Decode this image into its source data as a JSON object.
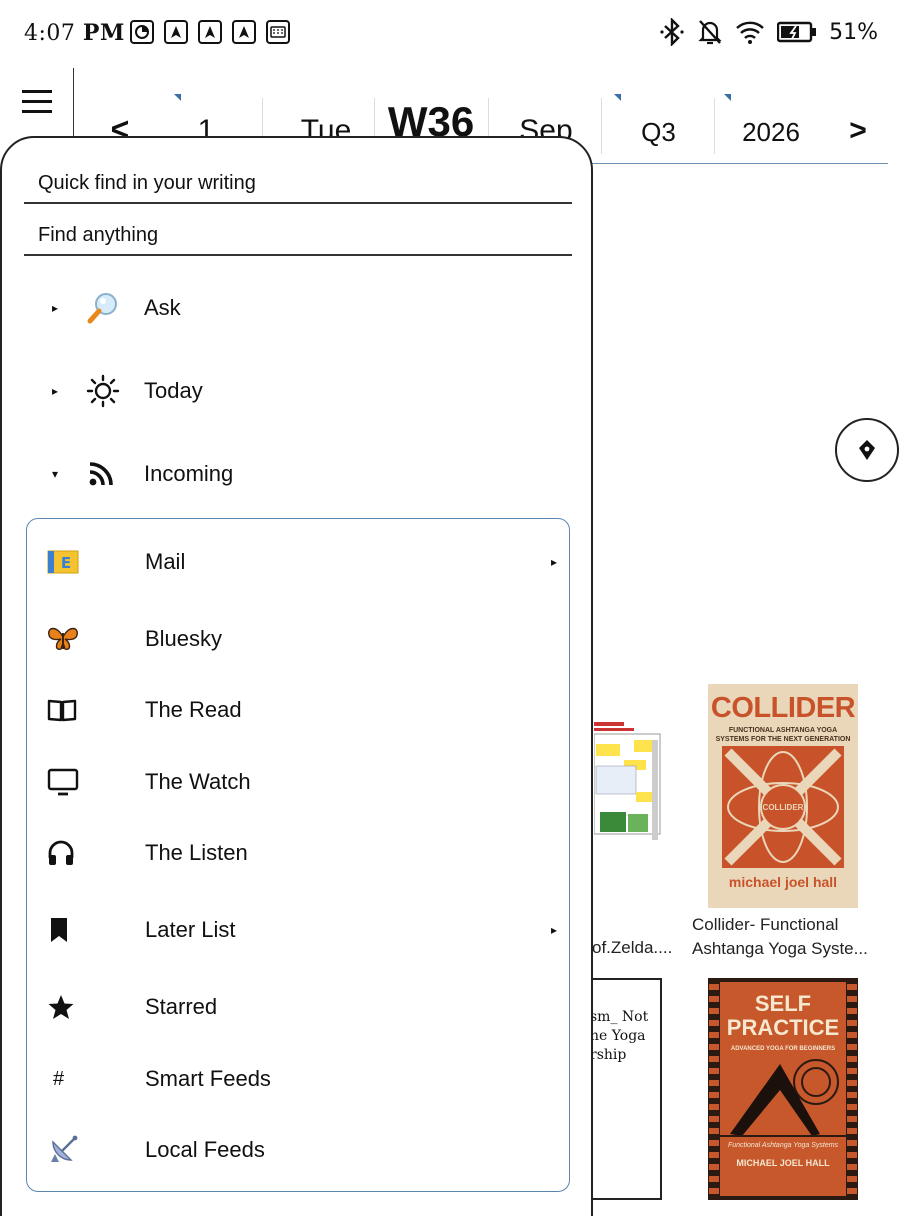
{
  "status": {
    "time": "4:07",
    "ampm": "PM",
    "battery": "51%"
  },
  "datebar": {
    "prev": "<",
    "day": "1",
    "weekday": "Tue",
    "week": "W36",
    "month": "Sep",
    "quarter": "Q3",
    "year": "2026",
    "next": ">"
  },
  "drawer": {
    "quick_find": "Quick find in your writing",
    "find_anything": "Find anything",
    "nav": [
      {
        "label": "Ask",
        "icon": "magnifier-icon"
      },
      {
        "label": "Today",
        "icon": "sun-icon"
      },
      {
        "label": "Incoming",
        "icon": "rss-icon"
      }
    ],
    "incoming": [
      {
        "label": "Mail",
        "icon": "mail-icon"
      },
      {
        "label": "Bluesky",
        "icon": "butterfly-icon"
      },
      {
        "label": "The Read",
        "icon": "book-icon"
      },
      {
        "label": "The Watch",
        "icon": "monitor-icon"
      },
      {
        "label": "The Listen",
        "icon": "headphones-icon"
      },
      {
        "label": "Later List",
        "icon": "bookmark-icon"
      },
      {
        "label": "Starred",
        "icon": "star-icon"
      },
      {
        "label": "Smart Feeds",
        "icon": "hash-icon"
      },
      {
        "label": "Local Feeds",
        "icon": "satellite-icon"
      }
    ]
  },
  "books": {
    "collider_cover_title": "COLLIDER",
    "collider_cover_sub": "FUNCTIONAL ASHTANGA YOGA SYSTEMS FOR THE NEXT GENERATION",
    "collider_cover_center": "COLLIDER",
    "collider_cover_author": "michael joel hall",
    "collider_title_1": "Collider- Functional",
    "collider_title_2": "Ashtanga Yoga Syste...",
    "self_cover_title_1": "SELF",
    "self_cover_title_2": "PRACTICE",
    "self_cover_sub": "ADVANCED YOGA FOR BEGINNERS",
    "self_cover_tag": "Functional Ashtanga Yoga Systems",
    "self_cover_author": "MICHAEL JOEL HALL",
    "zelda_title_cut": "of.Zelda....",
    "notes_line1": "sm_ Not",
    "notes_line2": "he Yoga",
    "notes_line3": "rship"
  },
  "colors": {
    "accent": "#5a87b0",
    "collider_orange": "#c8532a",
    "collider_bg": "#ead6b8"
  }
}
